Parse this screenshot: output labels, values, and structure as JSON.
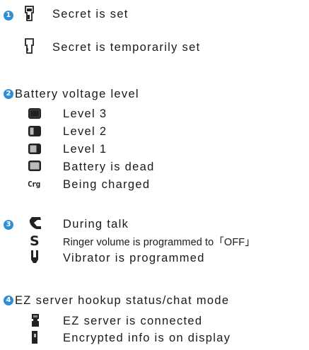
{
  "accent_color": "#2f8fd6",
  "sections": [
    {
      "number": "1",
      "heading": "",
      "items": [
        {
          "icon": "key-icon",
          "text": "Secret is set"
        },
        {
          "icon": "key-outline-icon",
          "text": "Secret is temporarily set"
        }
      ]
    },
    {
      "number": "2",
      "heading": "Battery voltage level",
      "items": [
        {
          "icon": "battery-level-3-icon",
          "text": "Level 3"
        },
        {
          "icon": "battery-level-2-icon",
          "text": "Level 2"
        },
        {
          "icon": "battery-level-1-icon",
          "text": "Level 1"
        },
        {
          "icon": "battery-dead-icon",
          "text": "Battery is dead"
        },
        {
          "icon": "charging-icon",
          "text": "Being charged"
        }
      ]
    },
    {
      "number": "3",
      "heading": "",
      "items": [
        {
          "icon": "phone-handset-icon",
          "text": "During talk"
        },
        {
          "icon": "silent-s-icon",
          "text": "Ringer volume is programmed to「OFF」"
        },
        {
          "icon": "vibrator-icon",
          "text": "Vibrator is programmed"
        }
      ]
    },
    {
      "number": "4",
      "heading": "EZ server hookup status/chat mode",
      "items": [
        {
          "icon": "ez-server-connected-icon",
          "text": "EZ server is connected"
        },
        {
          "icon": "encrypted-info-icon",
          "text": "Encrypted info is on display"
        }
      ]
    }
  ]
}
